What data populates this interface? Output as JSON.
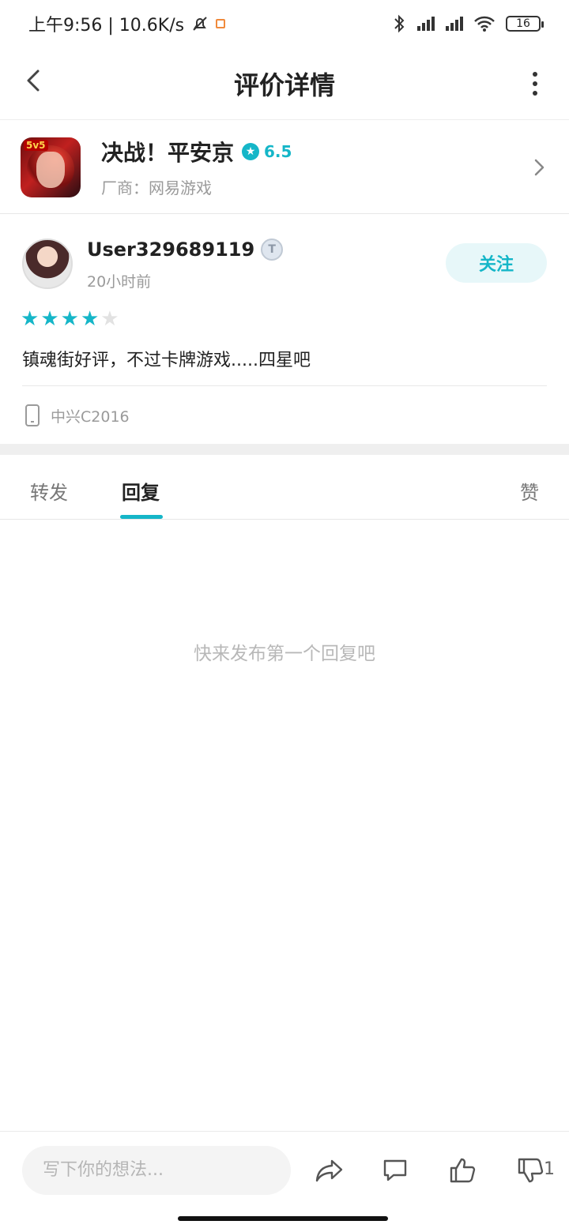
{
  "status_bar": {
    "time_speed": "上午9:56 | 10.6K/s",
    "battery": "16"
  },
  "header": {
    "title": "评价详情"
  },
  "game": {
    "name": "决战！平安京",
    "rating": "6.5",
    "vendor": "厂商：网易游戏",
    "icon_tag": "5v5"
  },
  "review": {
    "username": "User329689119",
    "level_badge": "T",
    "time": "20小时前",
    "follow_label": "关注",
    "stars": 4,
    "stars_max": 5,
    "text": "镇魂街好评，不过卡牌游戏.....四星吧",
    "device": "中兴C2016"
  },
  "tabs": [
    {
      "label": "转发"
    },
    {
      "label": "回复"
    },
    {
      "label": "赞"
    }
  ],
  "active_tab": "回复",
  "empty_message": "快来发布第一个回复吧",
  "bottom": {
    "placeholder": "写下你的想法...",
    "downvote_count": "1"
  },
  "colors": {
    "accent": "#15b6c8"
  },
  "icons": [
    "back-icon",
    "more-icon",
    "chevron-right-icon",
    "phone-icon",
    "share-icon",
    "comment-icon",
    "thumbs-up-icon",
    "thumbs-down-icon",
    "bluetooth-icon",
    "signal-icon",
    "wifi-icon",
    "mute-bell-icon"
  ]
}
